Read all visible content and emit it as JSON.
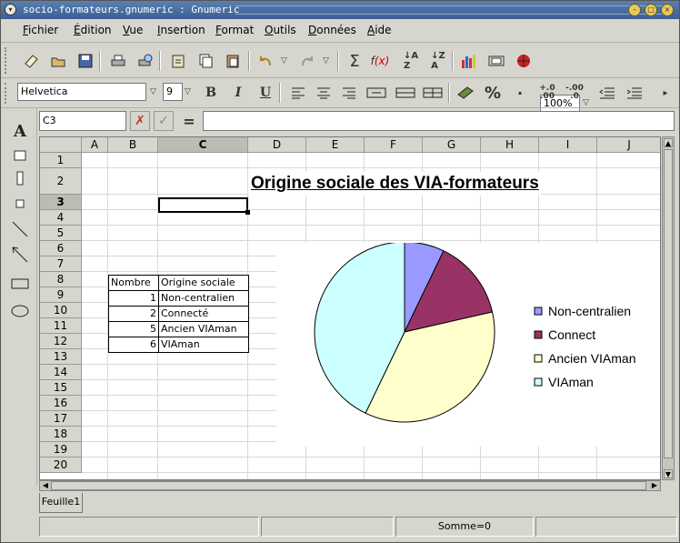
{
  "window": {
    "title": "socio-formateurs.gnumeric : Gnumeric"
  },
  "menu": [
    "Fichier",
    "Édition",
    "Vue",
    "Insertion",
    "Format",
    "Outils",
    "Données",
    "Aide"
  ],
  "toolbar": {
    "zoom": "100%"
  },
  "format_bar": {
    "font": "Helvetica",
    "size": "9",
    "bold": "B",
    "italic": "I",
    "underline": "U",
    "percent": "%",
    "thousands": "·",
    "dec_inc": "+.0\n.00",
    "dec_dec": "-.00\n.0"
  },
  "formula_bar": {
    "cell_ref": "C3",
    "cancel": "✗",
    "accept": "✓",
    "equals": "=",
    "value": ""
  },
  "columns": [
    "A",
    "B",
    "C",
    "D",
    "E",
    "F",
    "G",
    "H",
    "I",
    "J"
  ],
  "rows": [
    "1",
    "2",
    "3",
    "4",
    "5",
    "6",
    "7",
    "8",
    "9",
    "10",
    "11",
    "12",
    "13",
    "14",
    "15",
    "16",
    "17",
    "18",
    "19",
    "20"
  ],
  "sheet_title": "Origine sociale des VIA-formateurs",
  "table": {
    "headers": [
      "Nombre",
      "Origine sociale"
    ],
    "rows": [
      [
        "1",
        "Non-centralien"
      ],
      [
        "2",
        "Connecté"
      ],
      [
        "5",
        "Ancien VIAman"
      ],
      [
        "6",
        "VIAman"
      ]
    ]
  },
  "chart_data": {
    "type": "pie",
    "values": [
      1,
      2,
      5,
      6
    ],
    "labels": [
      "Non-centralien",
      "Connect",
      "Ancien VIAman",
      "VIAman"
    ],
    "colors": [
      "#9999ff",
      "#993366",
      "#ffffcc",
      "#ccffff"
    ],
    "legend": "right"
  },
  "sheet_tab": "Feuille1",
  "status": {
    "sum": "Somme=0"
  }
}
